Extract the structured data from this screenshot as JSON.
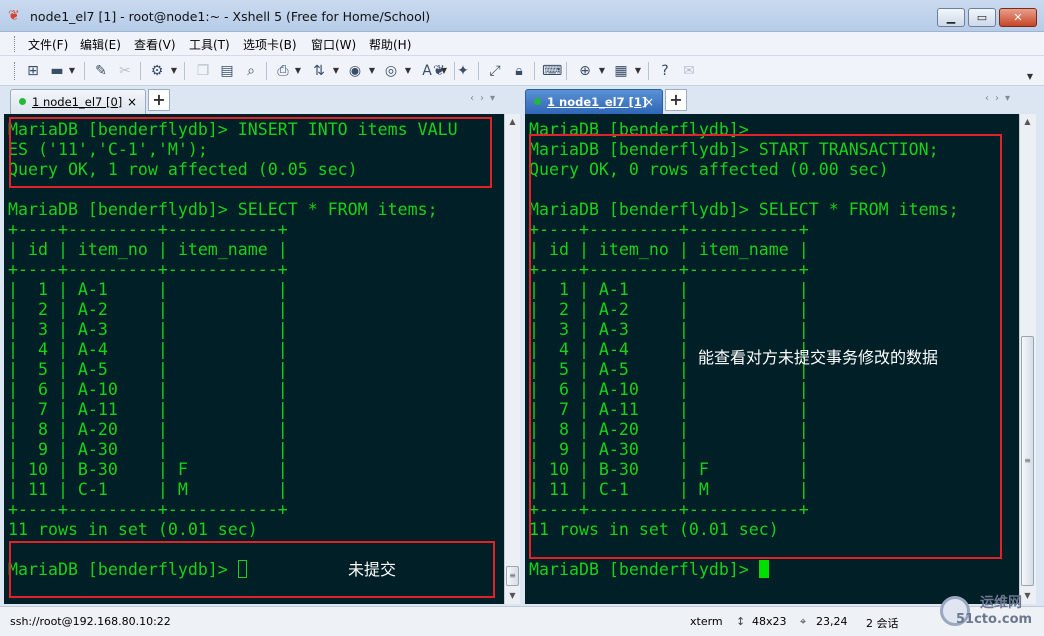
{
  "window": {
    "title": "node1_el7 [1] - root@node1:~ - Xshell 5 (Free for Home/School)",
    "app_icon": "xshell-logo-icon",
    "controls": [
      "minimize",
      "maximize",
      "close"
    ]
  },
  "menu": [
    "文件(F)",
    "编辑(E)",
    "查看(V)",
    "工具(T)",
    "选项卡(B)",
    "窗口(W)",
    "帮助(H)"
  ],
  "toolbar": {
    "icons": [
      "new-session-icon",
      "open-folder-icon",
      "reconnect-icon",
      "disconnect-icon",
      "properties-icon",
      "copy-icon",
      "paste-icon",
      "find-icon",
      "print-icon",
      "transfer-icon",
      "color-scheme-icon",
      "globe-icon",
      "font-icon",
      "xftp-icon",
      "xmanager-icon",
      "fullscreen-icon",
      "lock-icon",
      "keyboard-icon",
      "add-tab-icon",
      "layout-icon",
      "help-icon",
      "chat-icon"
    ]
  },
  "left_pane": {
    "tab_label": "1 node1_el7 [0]",
    "lines": [
      "MariaDB [benderflydb]> INSERT INTO items VALU",
      "ES ('11','C-1','M');",
      "Query OK, 1 row affected (0.05 sec)",
      "",
      "MariaDB [benderflydb]> SELECT * FROM items;",
      "+----+---------+-----------+",
      "| id | item_no | item_name |",
      "+----+---------+-----------+",
      "|  1 | A-1     |           |",
      "|  2 | A-2     |           |",
      "|  3 | A-3     |           |",
      "|  4 | A-4     |           |",
      "|  5 | A-5     |           |",
      "|  6 | A-10    |           |",
      "|  7 | A-11    |           |",
      "|  8 | A-20    |           |",
      "|  9 | A-30    |           |",
      "| 10 | B-30    | F         |",
      "| 11 | C-1     | M         |",
      "+----+---------+-----------+",
      "11 rows in set (0.01 sec)",
      "",
      "MariaDB [benderflydb]> "
    ],
    "annotation": "未提交"
  },
  "right_pane": {
    "tab_label": "1 node1_el7 [1]",
    "lines": [
      "MariaDB [benderflydb]>",
      "MariaDB [benderflydb]> START TRANSACTION;",
      "Query OK, 0 rows affected (0.00 sec)",
      "",
      "MariaDB [benderflydb]> SELECT * FROM items;",
      "+----+---------+-----------+",
      "| id | item_no | item_name |",
      "+----+---------+-----------+",
      "|  1 | A-1     |           |",
      "|  2 | A-2     |           |",
      "|  3 | A-3     |           |",
      "|  4 | A-4     |           |",
      "|  5 | A-5     |           |",
      "|  6 | A-10    |           |",
      "|  7 | A-11    |           |",
      "|  8 | A-20    |           |",
      "|  9 | A-30    |           |",
      "| 10 | B-30    | F         |",
      "| 11 | C-1     | M         |",
      "+----+---------+-----------+",
      "11 rows in set (0.01 sec)",
      "",
      "MariaDB [benderflydb]> "
    ],
    "annotation": "能查看对方未提交事务修改的数据"
  },
  "statusbar": {
    "connection": "ssh://root@192.168.80.10:22",
    "terminal": "xterm",
    "size": "48x23",
    "cursor": "23,24",
    "sessions": "2 会话",
    "watermark_top": "运维网",
    "watermark_bottom": "51cto.com"
  },
  "colors": {
    "terminal_bg": "#001f26",
    "terminal_fg": "#18d118",
    "annotation_box": "#e0242a",
    "active_tab": "#2e67b6"
  }
}
